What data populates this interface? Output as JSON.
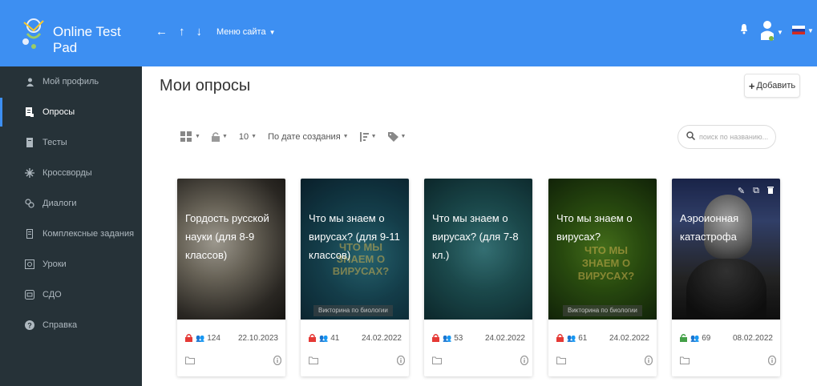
{
  "header": {
    "app_name": "Online Test Pad",
    "menu_label": "Меню сайта",
    "back_icon": "←",
    "up_icon": "↑",
    "down_icon": "↓"
  },
  "sidebar": {
    "items": [
      {
        "label": "Мой профиль",
        "icon": "user-icon"
      },
      {
        "label": "Опросы",
        "icon": "poll-icon",
        "active": true
      },
      {
        "label": "Тесты",
        "icon": "test-icon"
      },
      {
        "label": "Кроссворды",
        "icon": "crossword-icon"
      },
      {
        "label": "Диалоги",
        "icon": "dialog-icon"
      },
      {
        "label": "Комплексные задания",
        "icon": "complex-task-icon"
      },
      {
        "label": "Уроки",
        "icon": "lesson-icon"
      },
      {
        "label": "СДО",
        "icon": "lms-icon"
      },
      {
        "label": "Справка",
        "icon": "help-icon"
      }
    ]
  },
  "main": {
    "title": "Мои опросы",
    "add_label": "Добавить",
    "toolbar": {
      "per_page": "10",
      "sort_label": "По дате создания"
    },
    "search_placeholder": "поиск по названию..."
  },
  "cards": [
    {
      "title": "Гордость русской науки (для 8-9 классов)",
      "count": "124",
      "date": "22.10.2023",
      "locked": true
    },
    {
      "title": "Что мы знаем о вирусах? (для 9-11 классов)",
      "count": "41",
      "date": "24.02.2022",
      "locked": true,
      "caption": "Викторина по биологии",
      "watermark": "ЧТО МЫ ЗНАЕМ О ВИРУСАХ?"
    },
    {
      "title": "Что мы знаем о вирусах? (для 7-8 кл.)",
      "count": "53",
      "date": "24.02.2022",
      "locked": true
    },
    {
      "title": "Что мы знаем о вирусах?",
      "count": "61",
      "date": "24.02.2022",
      "locked": true,
      "caption": "Викторина по биологии",
      "watermark": "ЧТО МЫ ЗНАЕМ О ВИРУСАХ?"
    },
    {
      "title": "Аэроионная катастрофа",
      "count": "69",
      "date": "08.02.2022",
      "locked": false
    }
  ],
  "colors": {
    "header": "#3d8ff2",
    "sidebar": "#263238",
    "lock_red": "#e53935",
    "lock_green": "#43a047"
  }
}
